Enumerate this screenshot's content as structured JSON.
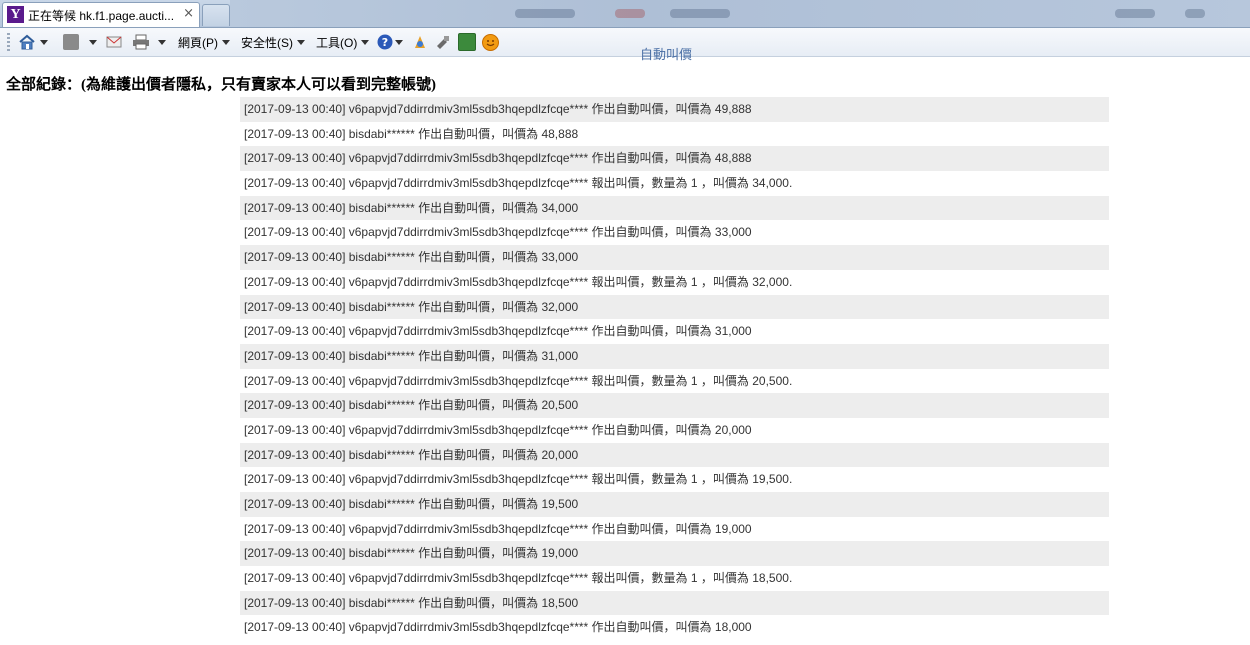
{
  "browser": {
    "tab_title": "正在等候 hk.f1.page.aucti...",
    "tab_close": "×",
    "favicon_letter": "Y"
  },
  "command_bar": {
    "menus": [
      {
        "label": "網頁(P)"
      },
      {
        "label": "安全性(S)"
      },
      {
        "label": "工具(O)"
      }
    ],
    "icons": [
      "home-icon",
      "feeds-icon",
      "mail-icon",
      "print-icon",
      "help-icon",
      "bookmark-icon",
      "tool-icon",
      "evernote-icon",
      "smiley-icon"
    ]
  },
  "page": {
    "cut_heading": "自動叫價",
    "section_title": "全部紀錄：(為維護出價者隱私，只有賣家本人可以看到完整帳號)",
    "records": [
      "[2017-09-13 00:40] v6papvjd7ddirrdmiv3ml5sdb3hqepdlzfcqe**** 作出自動叫價，叫價為 49,888",
      "[2017-09-13 00:40] bisdabi****** 作出自動叫價，叫價為 48,888",
      "[2017-09-13 00:40] v6papvjd7ddirrdmiv3ml5sdb3hqepdlzfcqe**** 作出自動叫價，叫價為 48,888",
      "[2017-09-13 00:40] v6papvjd7ddirrdmiv3ml5sdb3hqepdlzfcqe**** 報出叫價，數量為 1 ，叫價為 34,000.",
      "[2017-09-13 00:40] bisdabi****** 作出自動叫價，叫價為 34,000",
      "[2017-09-13 00:40] v6papvjd7ddirrdmiv3ml5sdb3hqepdlzfcqe**** 作出自動叫價，叫價為 33,000",
      "[2017-09-13 00:40] bisdabi****** 作出自動叫價，叫價為 33,000",
      "[2017-09-13 00:40] v6papvjd7ddirrdmiv3ml5sdb3hqepdlzfcqe**** 報出叫價，數量為 1 ，叫價為 32,000.",
      "[2017-09-13 00:40] bisdabi****** 作出自動叫價，叫價為 32,000",
      "[2017-09-13 00:40] v6papvjd7ddirrdmiv3ml5sdb3hqepdlzfcqe**** 作出自動叫價，叫價為 31,000",
      "[2017-09-13 00:40] bisdabi****** 作出自動叫價，叫價為 31,000",
      "[2017-09-13 00:40] v6papvjd7ddirrdmiv3ml5sdb3hqepdlzfcqe**** 報出叫價，數量為 1 ，叫價為 20,500.",
      "[2017-09-13 00:40] bisdabi****** 作出自動叫價，叫價為 20,500",
      "[2017-09-13 00:40] v6papvjd7ddirrdmiv3ml5sdb3hqepdlzfcqe**** 作出自動叫價，叫價為 20,000",
      "[2017-09-13 00:40] bisdabi****** 作出自動叫價，叫價為 20,000",
      "[2017-09-13 00:40] v6papvjd7ddirrdmiv3ml5sdb3hqepdlzfcqe**** 報出叫價，數量為 1 ，叫價為 19,500.",
      "[2017-09-13 00:40] bisdabi****** 作出自動叫價，叫價為 19,500",
      "[2017-09-13 00:40] v6papvjd7ddirrdmiv3ml5sdb3hqepdlzfcqe**** 作出自動叫價，叫價為 19,000",
      "[2017-09-13 00:40] bisdabi****** 作出自動叫價，叫價為 19,000",
      "[2017-09-13 00:40] v6papvjd7ddirrdmiv3ml5sdb3hqepdlzfcqe**** 報出叫價，數量為 1 ，叫價為 18,500.",
      "[2017-09-13 00:40] bisdabi****** 作出自動叫價，叫價為 18,500",
      "[2017-09-13 00:40] v6papvjd7ddirrdmiv3ml5sdb3hqepdlzfcqe**** 作出自動叫價，叫價為 18,000"
    ]
  },
  "colors": {
    "row_shade": "#ededed",
    "heading_link": "#4a6fa5"
  }
}
